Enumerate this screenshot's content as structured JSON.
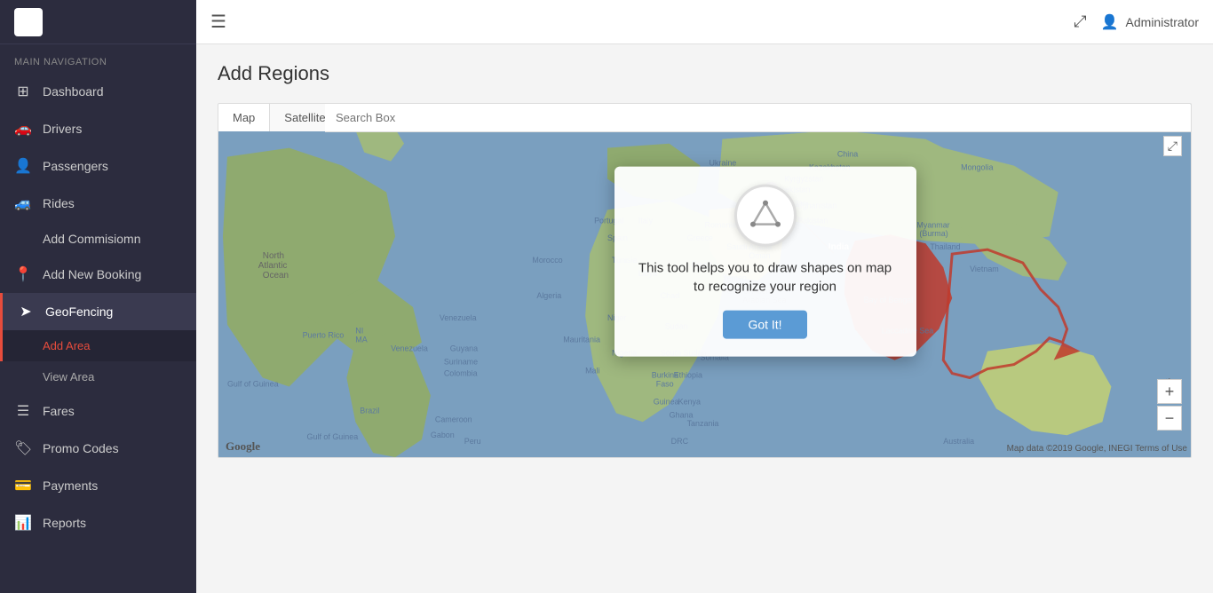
{
  "sidebar": {
    "section_title": "Main Navigation",
    "items": [
      {
        "id": "dashboard",
        "label": "Dashboard",
        "icon": "⊞"
      },
      {
        "id": "drivers",
        "label": "Drivers",
        "icon": "🚗"
      },
      {
        "id": "passengers",
        "label": "Passengers",
        "icon": "👤"
      },
      {
        "id": "rides",
        "label": "Rides",
        "icon": "🚙"
      },
      {
        "id": "add-commission",
        "label": "Add Commisiomn",
        "icon": ""
      },
      {
        "id": "add-new-booking",
        "label": "Add New Booking",
        "icon": "📍"
      },
      {
        "id": "geofencing",
        "label": "GeoFencing",
        "icon": "➤"
      },
      {
        "id": "fares",
        "label": "Fares",
        "icon": "☰"
      },
      {
        "id": "promo-codes",
        "label": "Promo Codes",
        "icon": "🏷"
      },
      {
        "id": "payments",
        "label": "Payments",
        "icon": "💳"
      },
      {
        "id": "reports",
        "label": "Reports",
        "icon": "📊"
      }
    ],
    "sub_items": [
      {
        "id": "add-area",
        "label": "Add Area"
      },
      {
        "id": "view-area",
        "label": "View Area"
      }
    ]
  },
  "topbar": {
    "hamburger_label": "☰",
    "admin_label": "Administrator",
    "expand_label": "⤢"
  },
  "page": {
    "title": "Add Regions"
  },
  "map": {
    "tab_map": "Map",
    "tab_satellite": "Satellite",
    "search_placeholder": "Search Box",
    "tooltip_text": "This tool helps you to draw shapes on map to recognize your region",
    "got_it_label": "Got It!",
    "watermark": "Google",
    "terms": "Map data ©2019 Google, INEGI   Terms of Use"
  }
}
